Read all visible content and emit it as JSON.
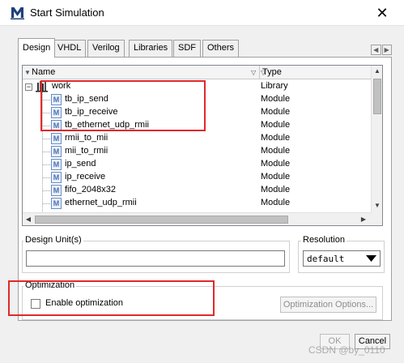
{
  "window": {
    "title": "Start Simulation",
    "close_glyph": "✕",
    "icon": "modelsim-m-icon"
  },
  "tabs": [
    {
      "label": "Design",
      "active": true
    },
    {
      "label": "VHDL"
    },
    {
      "label": "Verilog"
    },
    {
      "label": "Libraries"
    },
    {
      "label": "SDF"
    },
    {
      "label": "Others"
    }
  ],
  "tree": {
    "columns": {
      "name": "Name",
      "type": "Type"
    },
    "rows": [
      {
        "name": "work",
        "type": "Library"
      },
      {
        "name": "tb_ip_send",
        "type": "Module"
      },
      {
        "name": "tb_ip_receive",
        "type": "Module"
      },
      {
        "name": "tb_ethernet_udp_rmii",
        "type": "Module"
      },
      {
        "name": "rmii_to_mii",
        "type": "Module"
      },
      {
        "name": "mii_to_rmii",
        "type": "Module"
      },
      {
        "name": "ip_send",
        "type": "Module"
      },
      {
        "name": "ip_receive",
        "type": "Module"
      },
      {
        "name": "fifo_2048x32",
        "type": "Module"
      },
      {
        "name": "ethernet_udp_rmii",
        "type": "Module"
      }
    ]
  },
  "design_unit": {
    "label": "Design Unit(s)",
    "value": ""
  },
  "resolution": {
    "label": "Resolution",
    "value": "default"
  },
  "optimization": {
    "label": "Optimization",
    "checkbox_label": "Enable optimization",
    "checked": false,
    "options_button": "Optimization Options..."
  },
  "buttons": {
    "ok": "OK",
    "cancel": "Cancel"
  },
  "watermark": "CSDN @by_0110",
  "colors": {
    "highlight_box": "#e0292b"
  }
}
